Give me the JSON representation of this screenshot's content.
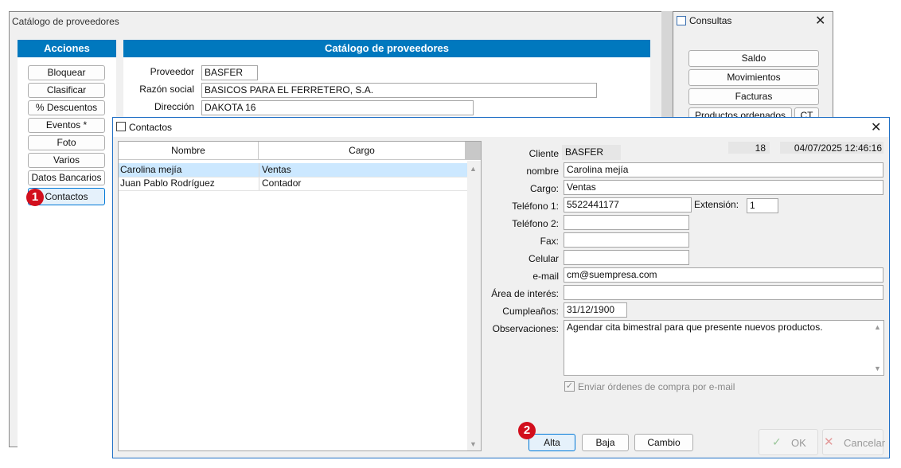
{
  "main_window": {
    "title": "Catálogo de proveedores",
    "acciones_header": "Acciones",
    "actions": [
      "Bloquear",
      "Clasificar",
      "% Descuentos",
      "Eventos *",
      "Foto",
      "Varios",
      "Datos Bancarios",
      "Contactos"
    ],
    "catalog_header": "Catálogo de proveedores",
    "proveedor_label": "Proveedor",
    "proveedor_value": "BASFER",
    "razon_label": "Razón social",
    "razon_value": "BASICOS PARA EL FERRETERO, S.A.",
    "direccion_label": "Dirección",
    "direccion_value": "DAKOTA 16"
  },
  "consultas": {
    "title": "Consultas",
    "buttons": [
      "Saldo",
      "Movimientos",
      "Facturas",
      "Productos ordenados",
      "CT"
    ]
  },
  "contactos": {
    "title": "Contactos",
    "columns": [
      "Nombre",
      "Cargo"
    ],
    "rows": [
      {
        "nombre": "Carolina mejía",
        "cargo": "Ventas"
      },
      {
        "nombre": "Juan Pablo Rodríguez",
        "cargo": "Contador"
      }
    ],
    "cliente_label": "Cliente",
    "cliente_value": "BASFER",
    "record_number": "18",
    "timestamp": "04/07/2025 12:46:16",
    "nombre_label": "nombre",
    "nombre_value": "Carolina mejía",
    "cargo_label": "Cargo:",
    "cargo_value": "Ventas",
    "tel1_label": "Teléfono 1:",
    "tel1_value": "5522441177",
    "ext_label": "Extensión:",
    "ext_value": "1",
    "tel2_label": "Teléfono 2:",
    "tel2_value": "",
    "fax_label": "Fax:",
    "fax_value": "",
    "celular_label": "Celular",
    "celular_value": "",
    "email_label": "e-mail",
    "email_value": "cm@suempresa.com",
    "area_label": "Área de interés:",
    "area_value": "",
    "cumple_label": "Cumpleaños:",
    "cumple_value": "31/12/1900",
    "obs_label": "Observaciones:",
    "obs_value": "Agendar cita bimestral para que presente nuevos productos.",
    "checkbox_label": "Enviar órdenes de compra por e-mail",
    "checkbox_checked": true,
    "alta": "Alta",
    "baja": "Baja",
    "cambio": "Cambio",
    "ok": "OK",
    "cancelar": "Cancelar"
  },
  "badges": {
    "one": "1",
    "two": "2"
  },
  "colors": {
    "header_blue": "#0078be",
    "selected_row": "#cce8ff",
    "badge_red": "#d20f1d"
  }
}
